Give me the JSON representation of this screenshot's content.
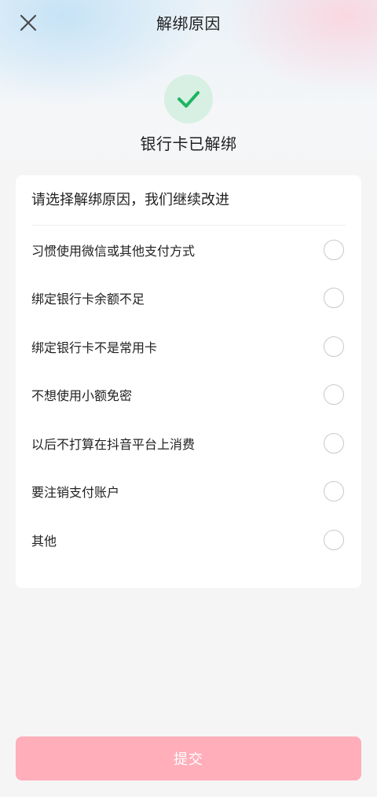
{
  "header": {
    "title": "解绑原因",
    "close_icon": "close-icon"
  },
  "status": {
    "icon": "check-icon",
    "text": "银行卡已解绑",
    "icon_color": "#1fb462",
    "icon_bg": "#d7f0e3"
  },
  "reasons": {
    "title": "请选择解绑原因，我们继续改进",
    "items": [
      {
        "label": "习惯使用微信或其他支付方式",
        "selected": false
      },
      {
        "label": "绑定银行卡余额不足",
        "selected": false
      },
      {
        "label": "绑定银行卡不是常用卡",
        "selected": false
      },
      {
        "label": "不想使用小额免密",
        "selected": false
      },
      {
        "label": "以后不打算在抖音平台上消费",
        "selected": false
      },
      {
        "label": "要注销支付账户",
        "selected": false
      },
      {
        "label": "其他",
        "selected": false
      }
    ]
  },
  "submit": {
    "label": "提交",
    "color": "#ffaeba",
    "enabled": false
  }
}
